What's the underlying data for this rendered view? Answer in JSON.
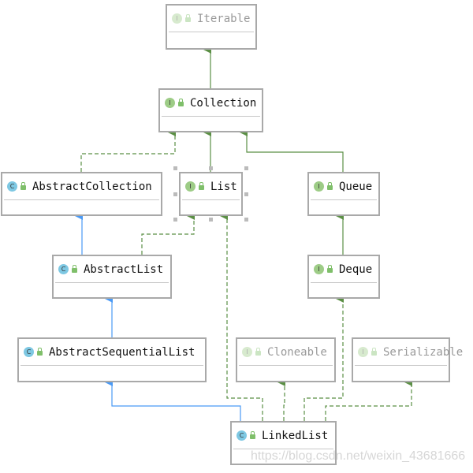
{
  "nodes": {
    "iterable": {
      "name": "Iterable",
      "kind": "interface",
      "badge": "I"
    },
    "collection": {
      "name": "Collection",
      "kind": "interface",
      "badge": "I"
    },
    "abstract_collection": {
      "name": "AbstractCollection",
      "kind": "class",
      "badge": "C"
    },
    "list": {
      "name": "List",
      "kind": "interface",
      "badge": "I"
    },
    "queue": {
      "name": "Queue",
      "kind": "interface",
      "badge": "I"
    },
    "abstract_list": {
      "name": "AbstractList",
      "kind": "class",
      "badge": "C"
    },
    "deque": {
      "name": "Deque",
      "kind": "interface",
      "badge": "I"
    },
    "abstract_sequential_list": {
      "name": "AbstractSequentialList",
      "kind": "class",
      "badge": "C"
    },
    "cloneable": {
      "name": "Cloneable",
      "kind": "interface",
      "badge": "I"
    },
    "serializable": {
      "name": "Serializable",
      "kind": "interface",
      "badge": "I"
    },
    "linked_list": {
      "name": "LinkedList",
      "kind": "class",
      "badge": "C"
    }
  },
  "edges": [
    {
      "from": "Collection",
      "to": "Iterable",
      "type": "extends"
    },
    {
      "from": "AbstractCollection",
      "to": "Collection",
      "type": "implements"
    },
    {
      "from": "List",
      "to": "Collection",
      "type": "extends"
    },
    {
      "from": "Queue",
      "to": "Collection",
      "type": "extends"
    },
    {
      "from": "AbstractList",
      "to": "AbstractCollection",
      "type": "class-extends"
    },
    {
      "from": "AbstractList",
      "to": "List",
      "type": "implements"
    },
    {
      "from": "Deque",
      "to": "Queue",
      "type": "extends"
    },
    {
      "from": "AbstractSequentialList",
      "to": "AbstractList",
      "type": "class-extends"
    },
    {
      "from": "LinkedList",
      "to": "AbstractSequentialList",
      "type": "class-extends"
    },
    {
      "from": "LinkedList",
      "to": "List",
      "type": "implements"
    },
    {
      "from": "LinkedList",
      "to": "Cloneable",
      "type": "implements"
    },
    {
      "from": "LinkedList",
      "to": "Deque",
      "type": "implements"
    },
    {
      "from": "LinkedList",
      "to": "Serializable",
      "type": "implements"
    }
  ],
  "colors": {
    "interface_edge": "#5b8f45",
    "class_edge": "#4a9af5",
    "border": "#a9a9a9"
  },
  "watermark": "https://blog.csdn.net/weixin_43681666"
}
